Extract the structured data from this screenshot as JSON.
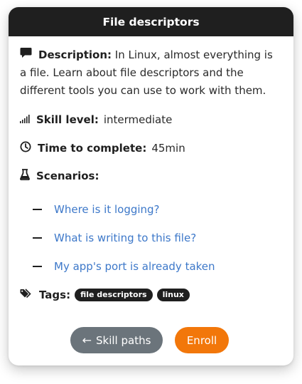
{
  "header": {
    "title": "File descriptors"
  },
  "description": {
    "label": "Description:",
    "text": "In Linux, almost everything is a file. Learn about file descriptors and the different tools you can use to work with them."
  },
  "skill": {
    "label": "Skill level:",
    "value": "intermediate"
  },
  "time": {
    "label": "Time to complete:",
    "value": "45min"
  },
  "scenarios": {
    "label": "Scenarios:",
    "items": [
      {
        "label": "Where is it logging?"
      },
      {
        "label": "What is writing to this file?"
      },
      {
        "label": "My app's port is already taken"
      }
    ]
  },
  "tags": {
    "label": "Tags:",
    "items": [
      "file descriptors",
      "linux"
    ]
  },
  "actions": {
    "back_label": "Skill paths",
    "back_arrow": "←",
    "enroll_label": "Enroll"
  },
  "colors": {
    "header_bg": "#1f1f1f",
    "link": "#3d78c9",
    "back_button": "#6b747b",
    "enroll_button": "#f2770a"
  },
  "icons": {
    "description": "comment-icon",
    "skill": "signal-bars-icon",
    "time": "clock-icon",
    "scenarios": "flask-icon",
    "tags": "tags-icon"
  }
}
